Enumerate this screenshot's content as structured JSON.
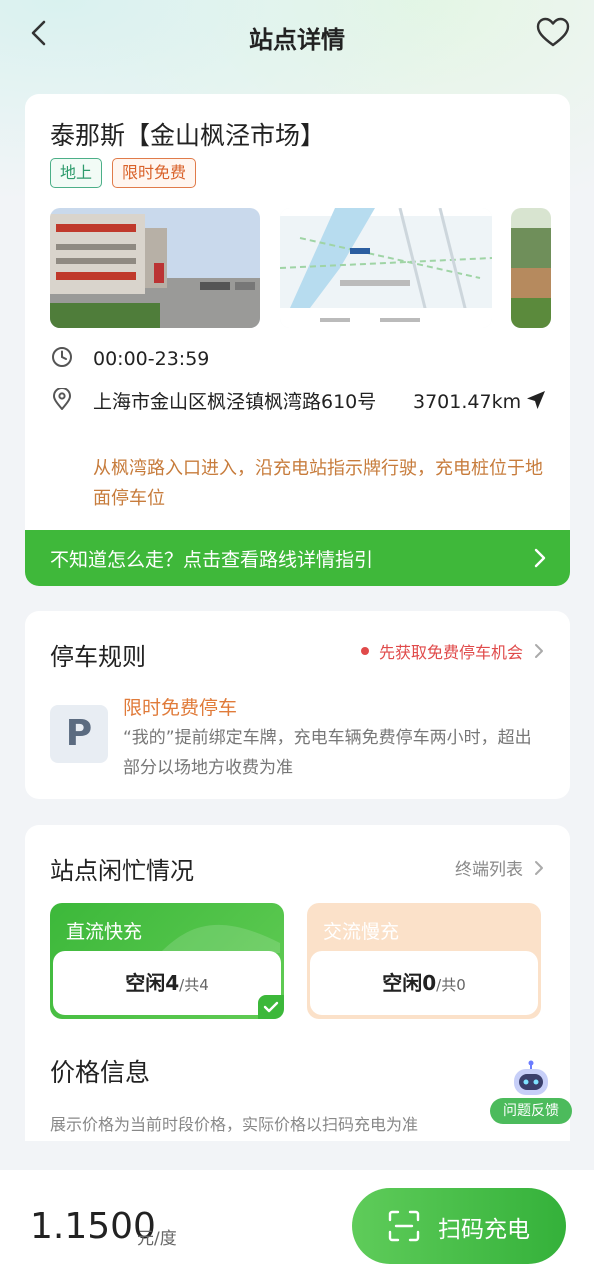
{
  "header": {
    "title": "站点详情",
    "back_icon": "chevron-left-icon",
    "favorite_icon": "heart-outline-icon"
  },
  "station": {
    "name": "泰那斯【金山枫泾市场】",
    "tags": [
      "地上",
      "限时免费"
    ],
    "hours": "00:00-23:59",
    "address": "上海市金山区枫泾镇枫湾路610号",
    "distance": "3701.47km",
    "route_hint": "从枫湾路入口进入，沿充电站指示牌行驶，充电桩位于地面停车位"
  },
  "route_guide": {
    "label": "不知道怎么走？点击查看路线详情指引"
  },
  "parking": {
    "title": "停车规则",
    "link": "先获取免费停车机会",
    "icon_letter": "P",
    "rule_title": "限时免费停车",
    "rule_desc": "“我的”提前绑定车牌，充电车辆免费停车两小时，超出部分以场地方收费为准"
  },
  "availability": {
    "title": "站点闲忙情况",
    "terminal_link": "终端列表",
    "dc": {
      "label": "直流快充",
      "status": "空闲4",
      "total": "/共4"
    },
    "ac": {
      "label": "交流慢充",
      "status": "空闲0",
      "total": "/共0"
    }
  },
  "price": {
    "title": "价格信息",
    "note": "展示价格为当前时段价格，实际价格以扫码充电为准",
    "value": "1.1500",
    "unit": "元/度"
  },
  "feedback": {
    "label": "问题反馈"
  },
  "scan_button": {
    "label": "扫码充电"
  },
  "colors": {
    "brand_green": "#3fb83a",
    "warning_orange": "#d9622a",
    "accent_red": "#e04a4a"
  }
}
